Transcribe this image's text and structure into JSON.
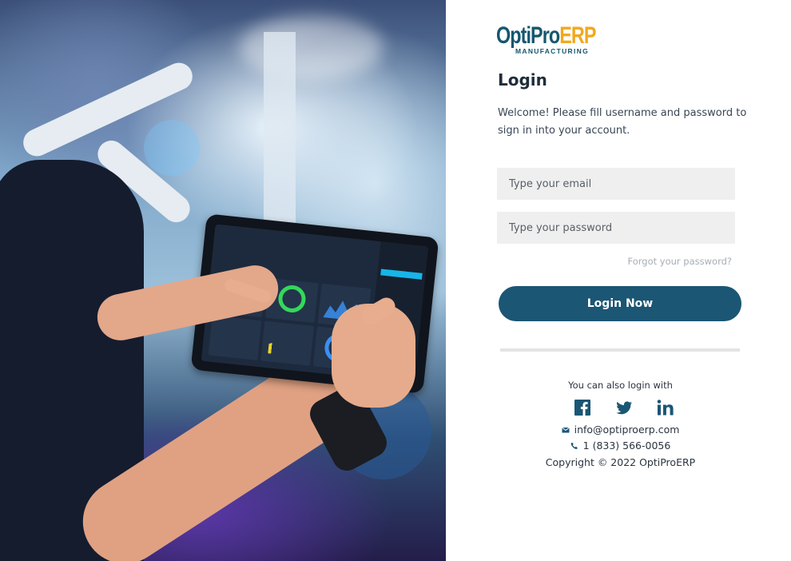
{
  "brand": {
    "name_part1": "OptiPro",
    "name_part2": "ERP",
    "subtitle": "MANUFACTURING",
    "primary_color": "#15576f",
    "accent_color": "#f2a81d"
  },
  "login": {
    "title": "Login",
    "welcome_text": "Welcome! Please fill username and password to sign in into your account.",
    "email_placeholder": "Type your email",
    "password_placeholder": "Type your password",
    "forgot_link": "Forgot your password?",
    "submit_label": "Login Now",
    "button_color": "#1b5674"
  },
  "social": {
    "heading": "You can also login with",
    "providers": [
      {
        "name": "Facebook",
        "icon": "facebook-icon"
      },
      {
        "name": "Twitter",
        "icon": "twitter-icon"
      },
      {
        "name": "LinkedIn",
        "icon": "linkedin-icon"
      }
    ]
  },
  "contact": {
    "email": "info@optiproerp.com",
    "phone": "1 (833) 566-0056",
    "copyright": "Copyright © 2022 OptiProERP"
  }
}
